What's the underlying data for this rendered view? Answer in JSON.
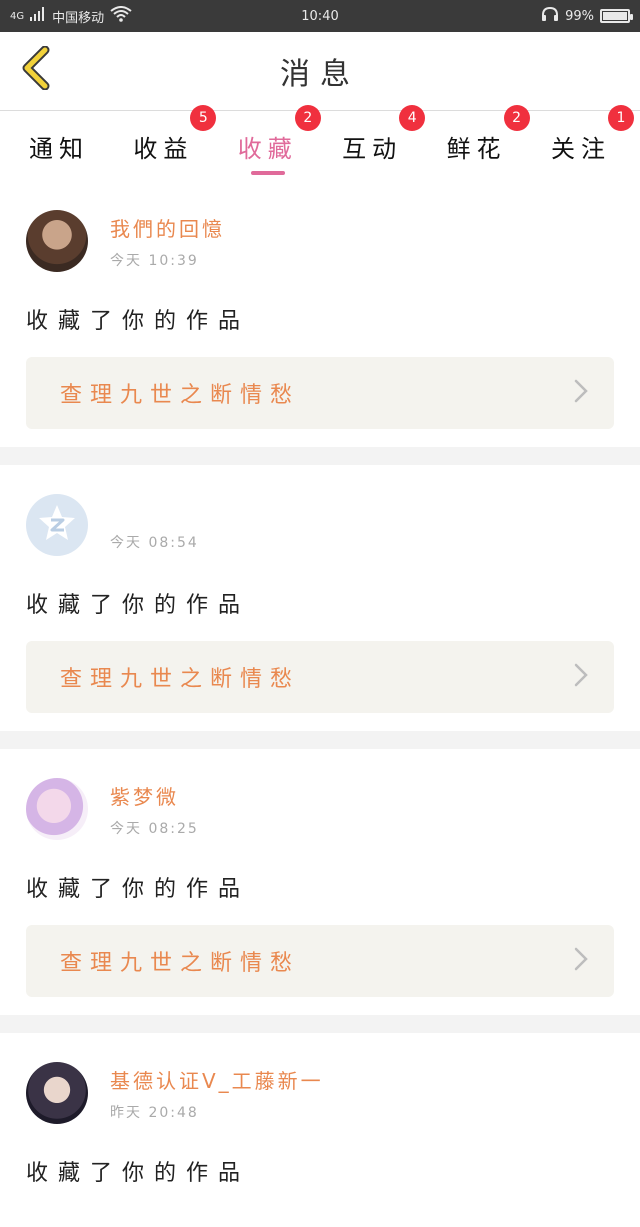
{
  "status": {
    "network": "4G",
    "carrier": "中国移动",
    "time": "10:40",
    "battery": "99%",
    "battery_level": 0.99
  },
  "header": {
    "title": "消息"
  },
  "tabs": [
    {
      "label": "通知",
      "badge": ""
    },
    {
      "label": "收益",
      "badge": "5"
    },
    {
      "label": "收藏",
      "badge": "2",
      "active": true
    },
    {
      "label": "互动",
      "badge": "4"
    },
    {
      "label": "鲜花",
      "badge": "2"
    },
    {
      "label": "关注",
      "badge": "1"
    }
  ],
  "messages": [
    {
      "name": "我們的回憶",
      "time": "今天 10:39",
      "action": "收藏了你的作品",
      "work": "查理九世之断情愁"
    },
    {
      "name": "",
      "time": "今天 08:54",
      "action": "收藏了你的作品",
      "work": "查理九世之断情愁"
    },
    {
      "name": "紫梦微",
      "time": "今天 08:25",
      "action": "收藏了你的作品",
      "work": "查理九世之断情愁"
    },
    {
      "name": "基德认证V_工藤新一",
      "time": "昨天 20:48",
      "action": "收藏了你的作品",
      "work": ""
    }
  ],
  "colors": {
    "accent_pink": "#e06a9a",
    "accent_orange": "#e9884f",
    "badge_red": "#f0303e",
    "back_arrow_yellow": "#f2d23a"
  },
  "icons": {
    "back": "chevron-left-icon",
    "chevron": "chevron-right-icon",
    "wifi": "wifi-icon",
    "signal": "signal-icon",
    "headset": "headset-icon",
    "battery": "battery-icon"
  }
}
